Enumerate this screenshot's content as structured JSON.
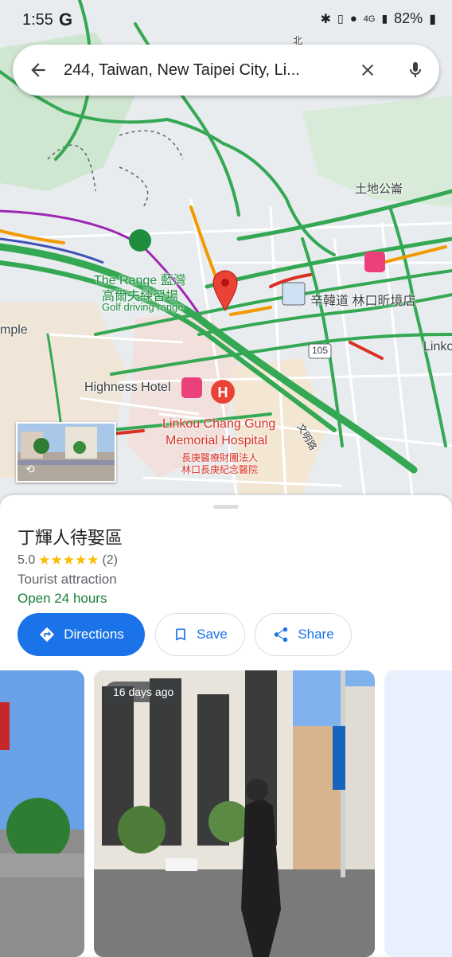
{
  "status": {
    "time": "1:55",
    "carrier_icon": "G",
    "battery": "82%"
  },
  "search": {
    "query": "244, Taiwan, New Taipei City, Li..."
  },
  "map_labels": {
    "park": "土地公崙",
    "range_en": "The Range 藍灣",
    "range_zh": "高爾夫練習場",
    "range_type": "Golf driving range",
    "hotel_right": "辛韓道 林口昕境店",
    "road_105": "105",
    "linko": "Linko",
    "mple": "mple",
    "highness": "Highness Hotel",
    "hospital_en_1": "Linkou Chang Gung",
    "hospital_en_2": "Memorial Hospital",
    "hospital_zh_1": "長庚醫療財團法人",
    "hospital_zh_2": "林口長庚紀念醫院",
    "road_top": "北",
    "road_side": "文明路"
  },
  "place": {
    "name": "丁輝人待娶區",
    "rating": "5.0",
    "stars": "★★★★★",
    "review_count": "(2)",
    "category": "Tourist attraction",
    "hours": "Open 24 hours"
  },
  "actions": {
    "directions": "Directions",
    "save": "Save",
    "share": "Share"
  },
  "photos": {
    "badge": "16 days ago"
  },
  "colors": {
    "accent": "#1a73e8",
    "open": "#188038",
    "pin": "#ea4335",
    "star": "#fbbc04"
  }
}
